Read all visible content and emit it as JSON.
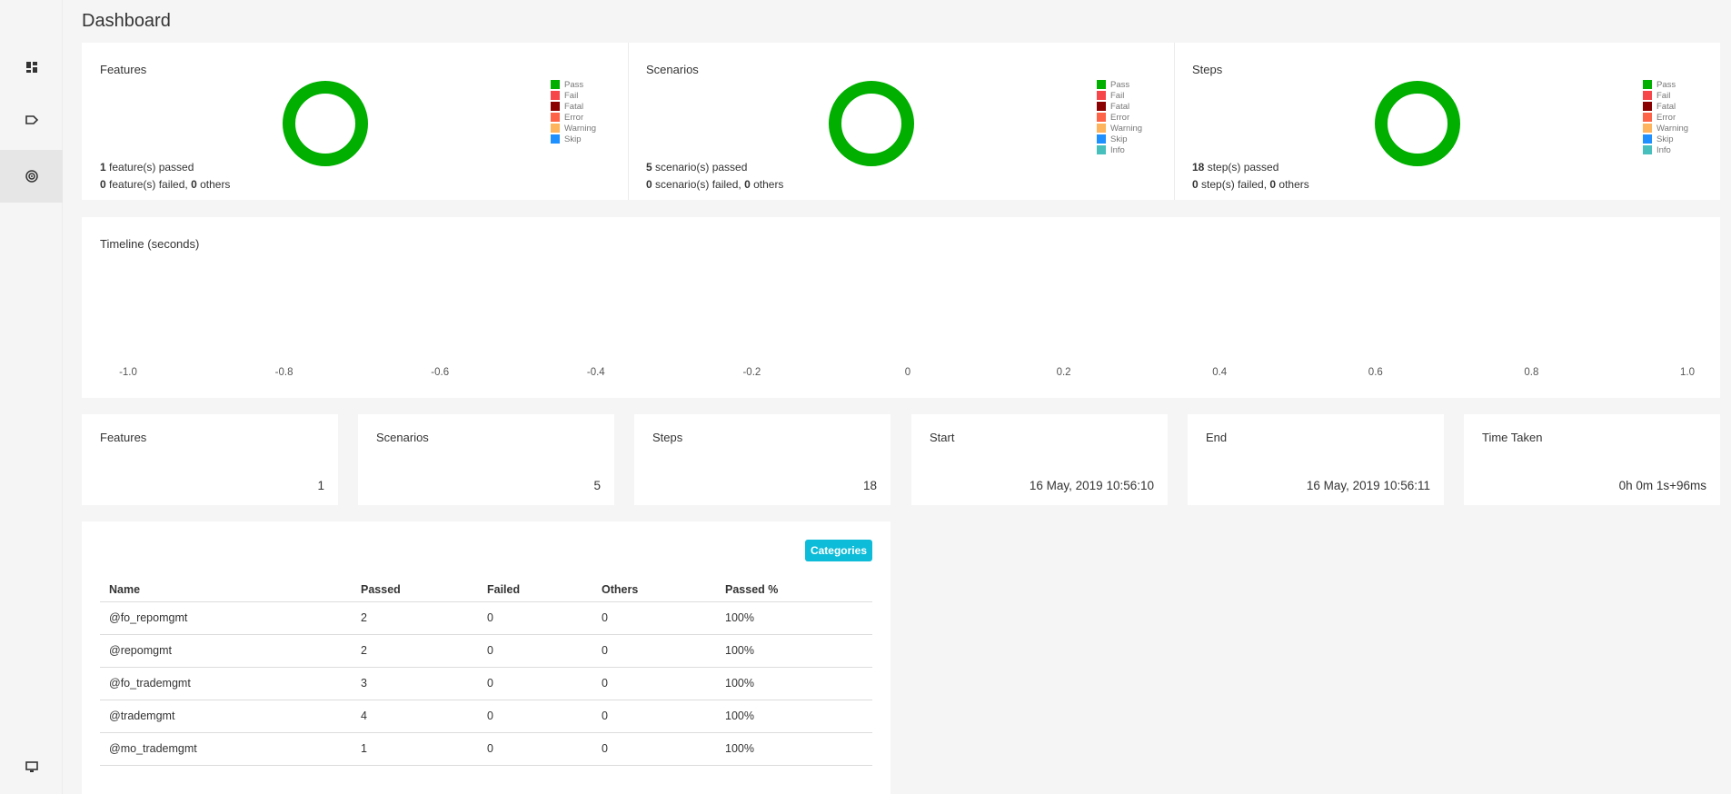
{
  "page": {
    "title": "Dashboard"
  },
  "sidebar": {
    "items": [
      {
        "name": "dashboard-icon"
      },
      {
        "name": "tag-icon"
      },
      {
        "name": "target-icon"
      },
      {
        "name": "monitor-icon"
      }
    ]
  },
  "legend": [
    "Pass",
    "Fail",
    "Fatal",
    "Error",
    "Warning",
    "Skip",
    "Info"
  ],
  "colors": {
    "pass": "#00af00",
    "fail": "#f7464a",
    "fatal": "#8b0000",
    "error": "#ff6347",
    "warning": "#fdb45c",
    "skip": "#1e90ff",
    "info": "#46bfbd",
    "accent": "#0dbcd8"
  },
  "donuts": {
    "features": {
      "title": "Features",
      "passed_n": "1",
      "passed_txt": " feature(s) passed",
      "failed_n": "0",
      "failed_txt": " feature(s) failed, ",
      "others_n": "0",
      "others_txt": " others",
      "pass_fraction": 1.0
    },
    "scenarios": {
      "title": "Scenarios",
      "passed_n": "5",
      "passed_txt": " scenario(s) passed",
      "failed_n": "0",
      "failed_txt": " scenario(s) failed, ",
      "others_n": "0",
      "others_txt": " others",
      "pass_fraction": 1.0
    },
    "steps": {
      "title": "Steps",
      "passed_n": "18",
      "passed_txt": " step(s) passed",
      "failed_n": "0",
      "failed_txt": " step(s) failed, ",
      "others_n": "0",
      "others_txt": " others",
      "pass_fraction": 1.0
    }
  },
  "timeline": {
    "title": "Timeline (seconds)",
    "ticks": [
      "-1.0",
      "-0.8",
      "-0.6",
      "-0.4",
      "-0.2",
      "0",
      "0.2",
      "0.4",
      "0.6",
      "0.8",
      "1.0"
    ]
  },
  "stats": {
    "features": {
      "label": "Features",
      "value": "1"
    },
    "scenarios": {
      "label": "Scenarios",
      "value": "5"
    },
    "steps": {
      "label": "Steps",
      "value": "18"
    },
    "start": {
      "label": "Start",
      "value": "16 May, 2019 10:56:10"
    },
    "end": {
      "label": "End",
      "value": "16 May, 2019 10:56:11"
    },
    "time_taken": {
      "label": "Time Taken",
      "value": "0h 0m 1s+96ms"
    }
  },
  "categories": {
    "button": "Categories",
    "headers": [
      "Name",
      "Passed",
      "Failed",
      "Others",
      "Passed %"
    ],
    "rows": [
      [
        "@fo_repomgmt",
        "2",
        "0",
        "0",
        "100%"
      ],
      [
        "@repomgmt",
        "2",
        "0",
        "0",
        "100%"
      ],
      [
        "@fo_trademgmt",
        "3",
        "0",
        "0",
        "100%"
      ],
      [
        "@trademgmt",
        "4",
        "0",
        "0",
        "100%"
      ],
      [
        "@mo_trademgmt",
        "1",
        "0",
        "0",
        "100%"
      ]
    ]
  }
}
